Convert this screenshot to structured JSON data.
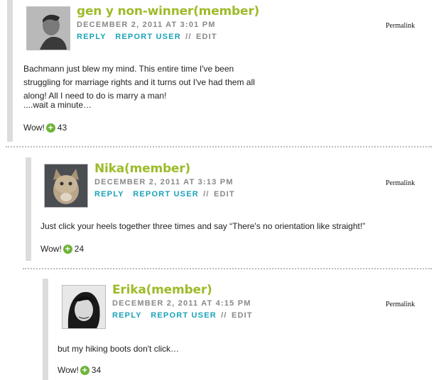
{
  "colors": {
    "name": "#9dbb2a",
    "action": "#1aa3b9",
    "meta": "#888888",
    "plus": "#6fb43a"
  },
  "comments": [
    {
      "name": "gen y non-winner(member)",
      "date": "DECEMBER 2, 2011 AT 3:01 PM",
      "reply": "REPLY",
      "report": "REPORT USER",
      "sep": "//",
      "edit": "EDIT",
      "permalink": "Permalink",
      "paragraphs": [
        "Bachmann just blew my mind. This entire time I've been struggling for marriage rights and it turns out I've had them all along! All I need to do is marry a man!",
        "....wait a minute…"
      ],
      "wow_label": "Wow!",
      "wow_count": "43"
    },
    {
      "name": "Nika(member)",
      "date": "DECEMBER 2, 2011 AT 3:13 PM",
      "reply": "REPLY",
      "report": "REPORT USER",
      "sep": "//",
      "edit": "EDIT",
      "permalink": "Permalink",
      "paragraphs": [
        "Just click your heels together three times and say “There's no orientation like straight!”"
      ],
      "wow_label": "Wow!",
      "wow_count": "24"
    },
    {
      "name": "Erika(member)",
      "date": "DECEMBER 2, 2011 AT 4:15 PM",
      "reply": "REPLY",
      "report": "REPORT USER",
      "sep": "//",
      "edit": "EDIT",
      "permalink": "Permalink",
      "paragraphs": [
        "but my hiking boots don't click…"
      ],
      "wow_label": "Wow!",
      "wow_count": "34"
    }
  ]
}
